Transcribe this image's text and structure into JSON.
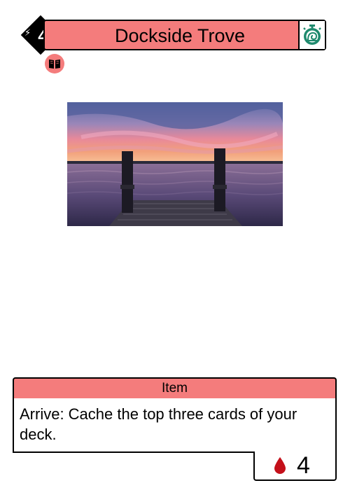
{
  "card": {
    "name": "Dockside Trove",
    "cost": "4",
    "cost_symbol": "⚡",
    "type": "Item",
    "rules_text": "Arrive: Cache the top three cards of your deck.",
    "blood_value": "4",
    "icons": {
      "speed": "snail-timer-icon",
      "set": "book-icon",
      "blood": "blood-drop-icon"
    },
    "colors": {
      "banner": "#f47c7c",
      "speed_icon": "#1f8a6e",
      "blood_icon": "#c4101a"
    }
  }
}
